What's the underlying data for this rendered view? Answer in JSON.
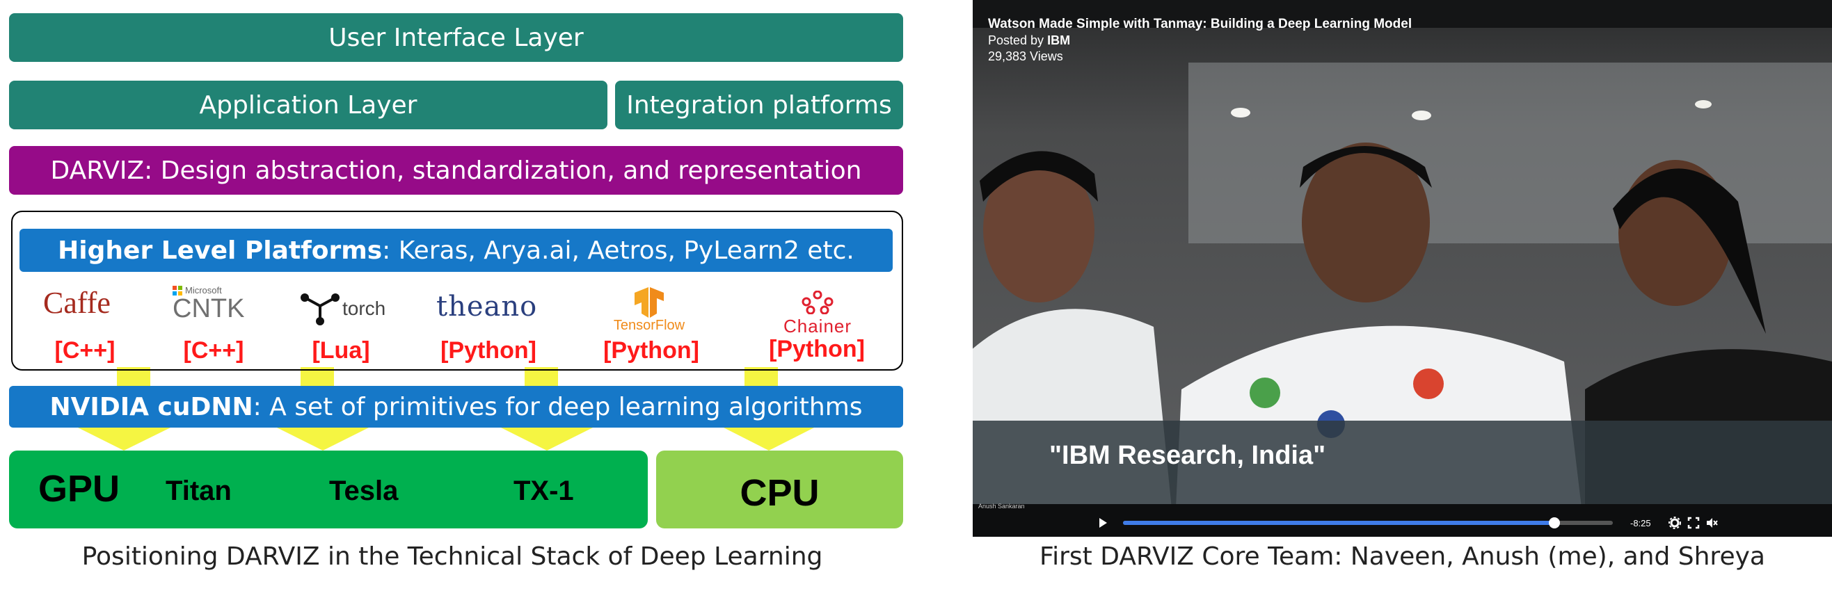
{
  "left": {
    "ui_layer": "User Interface Layer",
    "app_layer": "Application Layer",
    "integration": "Integration platforms",
    "darviz": "DARVIZ: Design abstraction, standardization, and representation",
    "higher_bold": "Higher Level Platforms",
    "higher_rest": ": Keras, Arya.ai, Aetros, PyLearn2 etc.",
    "frameworks": [
      {
        "name": "Caffe",
        "lang": "[C++]"
      },
      {
        "name": "CNTK",
        "sub": "Microsoft",
        "lang": "[C++]"
      },
      {
        "name": "torch",
        "lang": "[Lua]"
      },
      {
        "name": "theano",
        "lang": "[Python]"
      },
      {
        "name": "TensorFlow",
        "lang": "[Python]"
      },
      {
        "name": "Chainer",
        "lang": "[Python]"
      }
    ],
    "cudnn_bold": "NVIDIA cuDNN",
    "cudnn_rest": ": A set of primitives for deep learning algorithms",
    "gpu": "GPU",
    "gpu_items": [
      "Titan",
      "Tesla",
      "TX-1"
    ],
    "cpu": "CPU",
    "caption": "Positioning DARVIZ in the Technical Stack of Deep Learning"
  },
  "right": {
    "video_title": "Watson Made Simple with Tanmay: Building a Deep Learning Model",
    "posted_prefix": "Posted by ",
    "posted_by": "IBM",
    "views": "29,383 Views",
    "lower_third": "\"IBM Research, India\"",
    "small_name": "Anush Sankaran",
    "time_remaining": "-8:25",
    "progress": 0.88,
    "caption": "First DARVIZ Core Team: Naveen, Anush (me), and Shreya"
  },
  "colors": {
    "teal": "#218374",
    "purple": "#960b88",
    "blue": "#1678c8",
    "green": "#00b04f",
    "lime": "#92d14f",
    "arrow_yellow": "#f5f542",
    "lang_red": "#ff1a1a"
  },
  "icons": [
    "play-icon",
    "settings-icon",
    "fullscreen-icon",
    "mute-icon",
    "tensorflow-logo-icon",
    "chainer-logo-icon",
    "torch-logo-icon",
    "microsoft-logo-icon"
  ]
}
